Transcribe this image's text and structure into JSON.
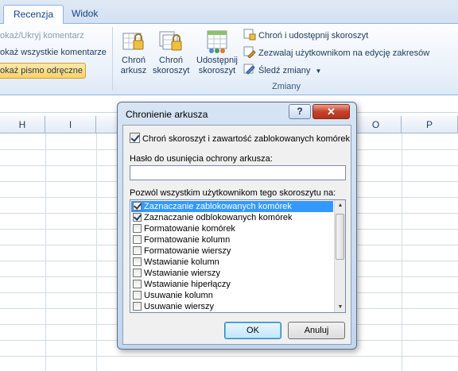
{
  "ribbon": {
    "tabs": [
      {
        "label": "Recenzja",
        "active": true
      },
      {
        "label": "Widok",
        "active": false
      }
    ],
    "comments": {
      "show_hide_comment": "okaż/Ukryj komentarz",
      "show_all_comments": "okaż wszystkie komentarze",
      "show_ink": "okaż pismo odręczne"
    },
    "changes_group": {
      "protect_sheet": "Chroń\narkusz",
      "protect_workbook": "Chroń\nskoroszyt",
      "share_workbook": "Udostępnij\nskoroszyt",
      "protect_and_share": "Chroń i udostępnij skoroszyt",
      "allow_users_edit_ranges": "Zezwalaj użytkownikom na edycję zakresów",
      "track_changes": "Śledź zmiany",
      "group_label": "Zmiany"
    }
  },
  "grid": {
    "columns": [
      "H",
      "I",
      "",
      "",
      "",
      "O",
      "P"
    ]
  },
  "dialog": {
    "title": "Chronienie arkusza",
    "help_glyph": "?",
    "close_glyph": "✕",
    "protect_checkbox_label": "Chroń skoroszyt i zawartość zablokowanych komórek",
    "protect_checked": true,
    "password_label": "Hasło do usunięcia ochrony arkusza:",
    "password_value": "",
    "allow_label": "Pozwól wszystkim użytkownikom tego skoroszytu na:",
    "permissions": [
      {
        "label": "Zaznaczanie zablokowanych komórek",
        "checked": true,
        "selected": true
      },
      {
        "label": "Zaznaczanie odblokowanych komórek",
        "checked": true,
        "selected": false
      },
      {
        "label": "Formatowanie komórek",
        "checked": false,
        "selected": false
      },
      {
        "label": "Formatowanie kolumn",
        "checked": false,
        "selected": false
      },
      {
        "label": "Formatowanie wierszy",
        "checked": false,
        "selected": false
      },
      {
        "label": "Wstawianie kolumn",
        "checked": false,
        "selected": false
      },
      {
        "label": "Wstawianie wierszy",
        "checked": false,
        "selected": false
      },
      {
        "label": "Wstawianie hiperłączy",
        "checked": false,
        "selected": false
      },
      {
        "label": "Usuwanie kolumn",
        "checked": false,
        "selected": false
      },
      {
        "label": "Usuwanie wierszy",
        "checked": false,
        "selected": false
      }
    ],
    "ok_label": "OK",
    "cancel_label": "Anuluj"
  }
}
